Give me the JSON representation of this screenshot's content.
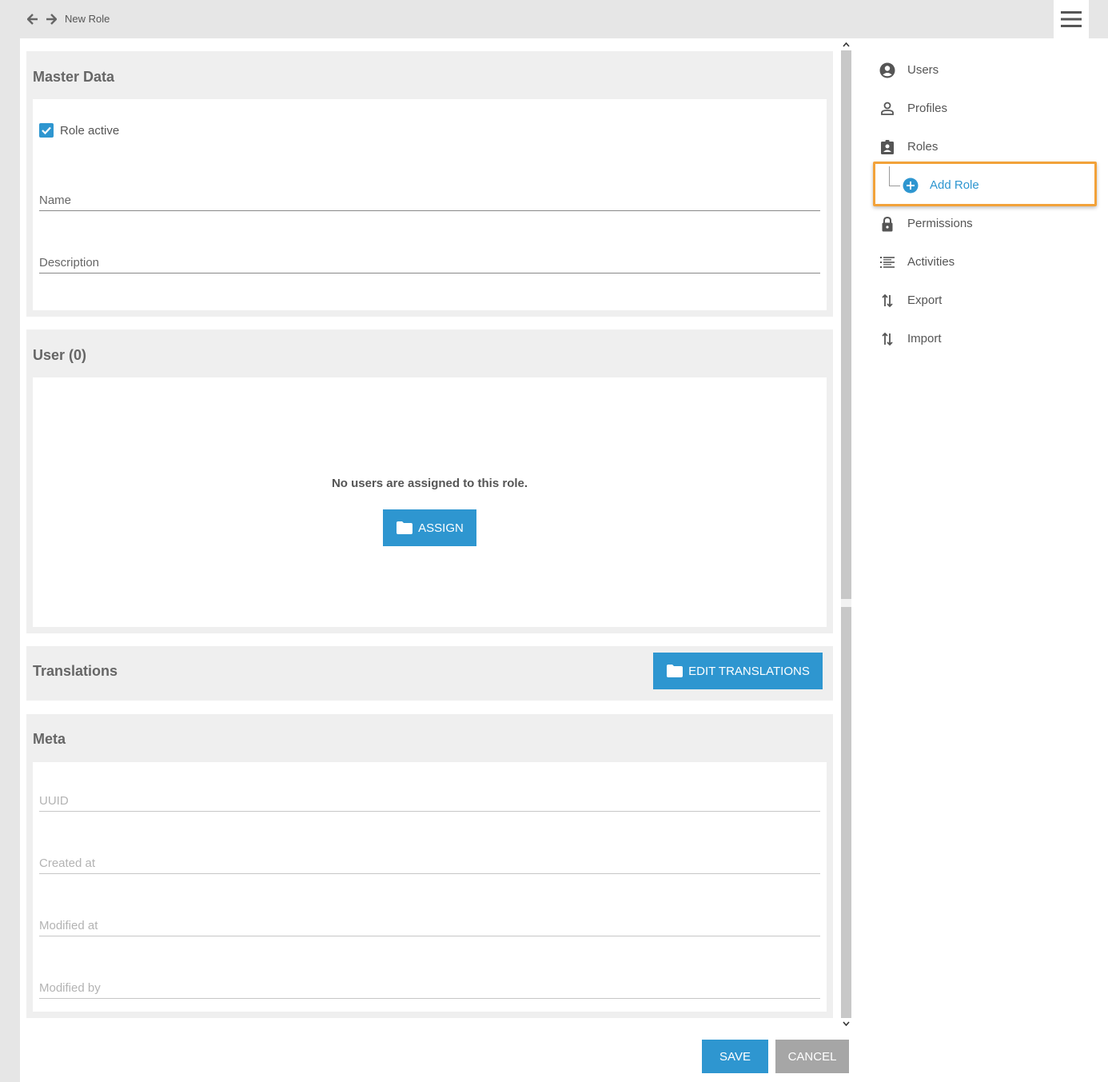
{
  "header": {
    "breadcrumb": "New Role",
    "back_icon": "arrow-left-icon",
    "forward_icon": "arrow-right-icon",
    "menu_icon": "hamburger-icon"
  },
  "master_data": {
    "title": "Master Data",
    "role_active_label": "Role active",
    "role_active_checked": true,
    "name_label": "Name",
    "name_value": "",
    "description_label": "Description",
    "description_value": ""
  },
  "users": {
    "title": "User (0)",
    "empty_message": "No users are assigned to this role.",
    "assign_label": "ASSIGN"
  },
  "translations": {
    "title": "Translations",
    "edit_label": "EDIT TRANSLATIONS"
  },
  "meta": {
    "title": "Meta",
    "uuid_label": "UUID",
    "created_label": "Created at",
    "modified_label": "Modified at",
    "modified_by_label": "Modified by"
  },
  "footer": {
    "save_label": "SAVE",
    "cancel_label": "CANCEL"
  },
  "sidebar": {
    "items": [
      {
        "label": "Users",
        "icon": "account-circle-icon"
      },
      {
        "label": "Profiles",
        "icon": "person-outline-icon"
      },
      {
        "label": "Roles",
        "icon": "assignment-ind-icon"
      },
      {
        "label": "Permissions",
        "icon": "lock-icon"
      },
      {
        "label": "Activities",
        "icon": "list-icon"
      },
      {
        "label": "Export",
        "icon": "swap-vert-icon"
      },
      {
        "label": "Import",
        "icon": "swap-vert-icon"
      }
    ],
    "sub_item": {
      "label": "Add Role",
      "icon": "add-circle-icon"
    }
  },
  "colors": {
    "accent": "#2e96d0",
    "highlight": "#f2a23a",
    "cancel": "#a6a6a6"
  }
}
